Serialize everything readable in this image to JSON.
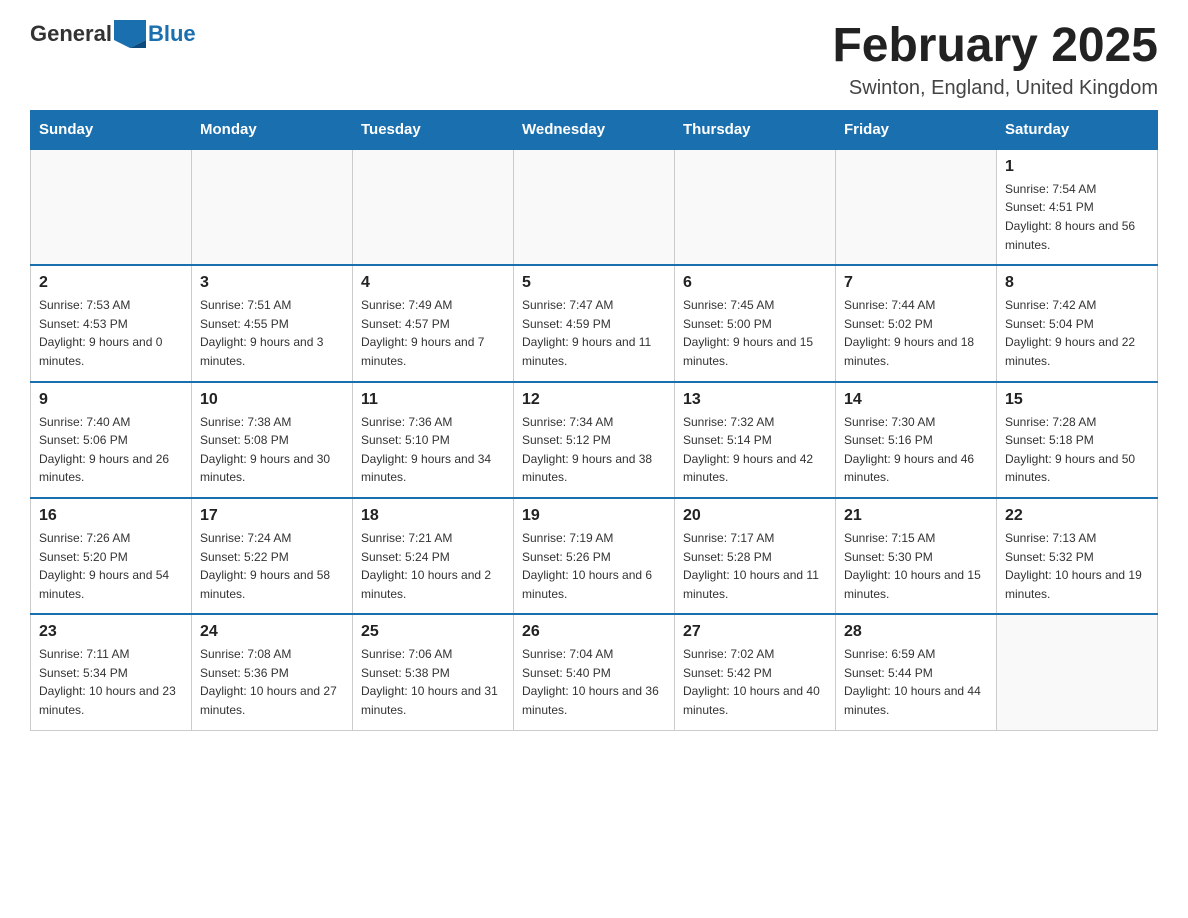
{
  "header": {
    "logo_text_general": "General",
    "logo_text_blue": "Blue",
    "month_title": "February 2025",
    "location": "Swinton, England, United Kingdom"
  },
  "days_of_week": [
    "Sunday",
    "Monday",
    "Tuesday",
    "Wednesday",
    "Thursday",
    "Friday",
    "Saturday"
  ],
  "weeks": [
    [
      {
        "day": "",
        "info": ""
      },
      {
        "day": "",
        "info": ""
      },
      {
        "day": "",
        "info": ""
      },
      {
        "day": "",
        "info": ""
      },
      {
        "day": "",
        "info": ""
      },
      {
        "day": "",
        "info": ""
      },
      {
        "day": "1",
        "info": "Sunrise: 7:54 AM\nSunset: 4:51 PM\nDaylight: 8 hours and 56 minutes."
      }
    ],
    [
      {
        "day": "2",
        "info": "Sunrise: 7:53 AM\nSunset: 4:53 PM\nDaylight: 9 hours and 0 minutes."
      },
      {
        "day": "3",
        "info": "Sunrise: 7:51 AM\nSunset: 4:55 PM\nDaylight: 9 hours and 3 minutes."
      },
      {
        "day": "4",
        "info": "Sunrise: 7:49 AM\nSunset: 4:57 PM\nDaylight: 9 hours and 7 minutes."
      },
      {
        "day": "5",
        "info": "Sunrise: 7:47 AM\nSunset: 4:59 PM\nDaylight: 9 hours and 11 minutes."
      },
      {
        "day": "6",
        "info": "Sunrise: 7:45 AM\nSunset: 5:00 PM\nDaylight: 9 hours and 15 minutes."
      },
      {
        "day": "7",
        "info": "Sunrise: 7:44 AM\nSunset: 5:02 PM\nDaylight: 9 hours and 18 minutes."
      },
      {
        "day": "8",
        "info": "Sunrise: 7:42 AM\nSunset: 5:04 PM\nDaylight: 9 hours and 22 minutes."
      }
    ],
    [
      {
        "day": "9",
        "info": "Sunrise: 7:40 AM\nSunset: 5:06 PM\nDaylight: 9 hours and 26 minutes."
      },
      {
        "day": "10",
        "info": "Sunrise: 7:38 AM\nSunset: 5:08 PM\nDaylight: 9 hours and 30 minutes."
      },
      {
        "day": "11",
        "info": "Sunrise: 7:36 AM\nSunset: 5:10 PM\nDaylight: 9 hours and 34 minutes."
      },
      {
        "day": "12",
        "info": "Sunrise: 7:34 AM\nSunset: 5:12 PM\nDaylight: 9 hours and 38 minutes."
      },
      {
        "day": "13",
        "info": "Sunrise: 7:32 AM\nSunset: 5:14 PM\nDaylight: 9 hours and 42 minutes."
      },
      {
        "day": "14",
        "info": "Sunrise: 7:30 AM\nSunset: 5:16 PM\nDaylight: 9 hours and 46 minutes."
      },
      {
        "day": "15",
        "info": "Sunrise: 7:28 AM\nSunset: 5:18 PM\nDaylight: 9 hours and 50 minutes."
      }
    ],
    [
      {
        "day": "16",
        "info": "Sunrise: 7:26 AM\nSunset: 5:20 PM\nDaylight: 9 hours and 54 minutes."
      },
      {
        "day": "17",
        "info": "Sunrise: 7:24 AM\nSunset: 5:22 PM\nDaylight: 9 hours and 58 minutes."
      },
      {
        "day": "18",
        "info": "Sunrise: 7:21 AM\nSunset: 5:24 PM\nDaylight: 10 hours and 2 minutes."
      },
      {
        "day": "19",
        "info": "Sunrise: 7:19 AM\nSunset: 5:26 PM\nDaylight: 10 hours and 6 minutes."
      },
      {
        "day": "20",
        "info": "Sunrise: 7:17 AM\nSunset: 5:28 PM\nDaylight: 10 hours and 11 minutes."
      },
      {
        "day": "21",
        "info": "Sunrise: 7:15 AM\nSunset: 5:30 PM\nDaylight: 10 hours and 15 minutes."
      },
      {
        "day": "22",
        "info": "Sunrise: 7:13 AM\nSunset: 5:32 PM\nDaylight: 10 hours and 19 minutes."
      }
    ],
    [
      {
        "day": "23",
        "info": "Sunrise: 7:11 AM\nSunset: 5:34 PM\nDaylight: 10 hours and 23 minutes."
      },
      {
        "day": "24",
        "info": "Sunrise: 7:08 AM\nSunset: 5:36 PM\nDaylight: 10 hours and 27 minutes."
      },
      {
        "day": "25",
        "info": "Sunrise: 7:06 AM\nSunset: 5:38 PM\nDaylight: 10 hours and 31 minutes."
      },
      {
        "day": "26",
        "info": "Sunrise: 7:04 AM\nSunset: 5:40 PM\nDaylight: 10 hours and 36 minutes."
      },
      {
        "day": "27",
        "info": "Sunrise: 7:02 AM\nSunset: 5:42 PM\nDaylight: 10 hours and 40 minutes."
      },
      {
        "day": "28",
        "info": "Sunrise: 6:59 AM\nSunset: 5:44 PM\nDaylight: 10 hours and 44 minutes."
      },
      {
        "day": "",
        "info": ""
      }
    ]
  ]
}
